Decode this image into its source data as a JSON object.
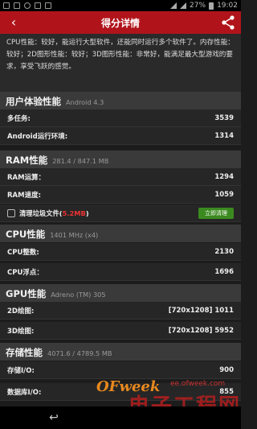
{
  "status_bar": {
    "battery": "27%",
    "time": "19:02"
  },
  "header": {
    "title": "得分详情"
  },
  "description": "CPU性能：较好，能运行大型软件，还能同时运行多个软件了。内存性能：较好；2D图形性能：较好；3D图形性能：非常好，能满足最大型游戏的要求，享受飞跃的感觉。",
  "sections": {
    "ux": {
      "title": "用户体验性能",
      "sub": "Android 4.3",
      "rows": [
        {
          "label": "多任务:",
          "value": "3539"
        },
        {
          "label": "Android运行环境:",
          "value": "1314"
        }
      ]
    },
    "ram": {
      "title": "RAM性能",
      "sub": "281.4 / 847.1 MB",
      "rows": [
        {
          "label": "RAM运算：",
          "value": "1294"
        },
        {
          "label": "RAM速度:",
          "value": "1059"
        }
      ],
      "clean": {
        "label": "清理垃圾文件(",
        "amount": "5.2MB",
        "close": ")",
        "button": "立即清理"
      }
    },
    "cpu": {
      "title": "CPU性能",
      "sub": "1401 MHz (x4)",
      "rows": [
        {
          "label": "CPU整数:",
          "value": "2130"
        },
        {
          "label": "CPU浮点：",
          "value": "1696"
        }
      ]
    },
    "gpu": {
      "title": "GPU性能",
      "sub": "Adreno (TM) 305",
      "rows": [
        {
          "label": "2D绘图:",
          "value": "[720x1208] 1011"
        },
        {
          "label": "3D绘图:",
          "value": "[720x1208] 5952"
        }
      ]
    },
    "storage": {
      "title": "存储性能",
      "sub": "4071.6 / 4789.5 MB",
      "rows": [
        {
          "label": "存储I/O:",
          "value": "900"
        },
        {
          "label": "数据库I/O:",
          "value": "855"
        }
      ]
    }
  },
  "watermark": {
    "brand": "OFweek",
    "url": "ee.ofweek.com",
    "cn": "电子工程网"
  },
  "colors": {
    "header": "#b0141a",
    "clean_button": "#3b8a1f",
    "highlight": "#ee3333"
  }
}
